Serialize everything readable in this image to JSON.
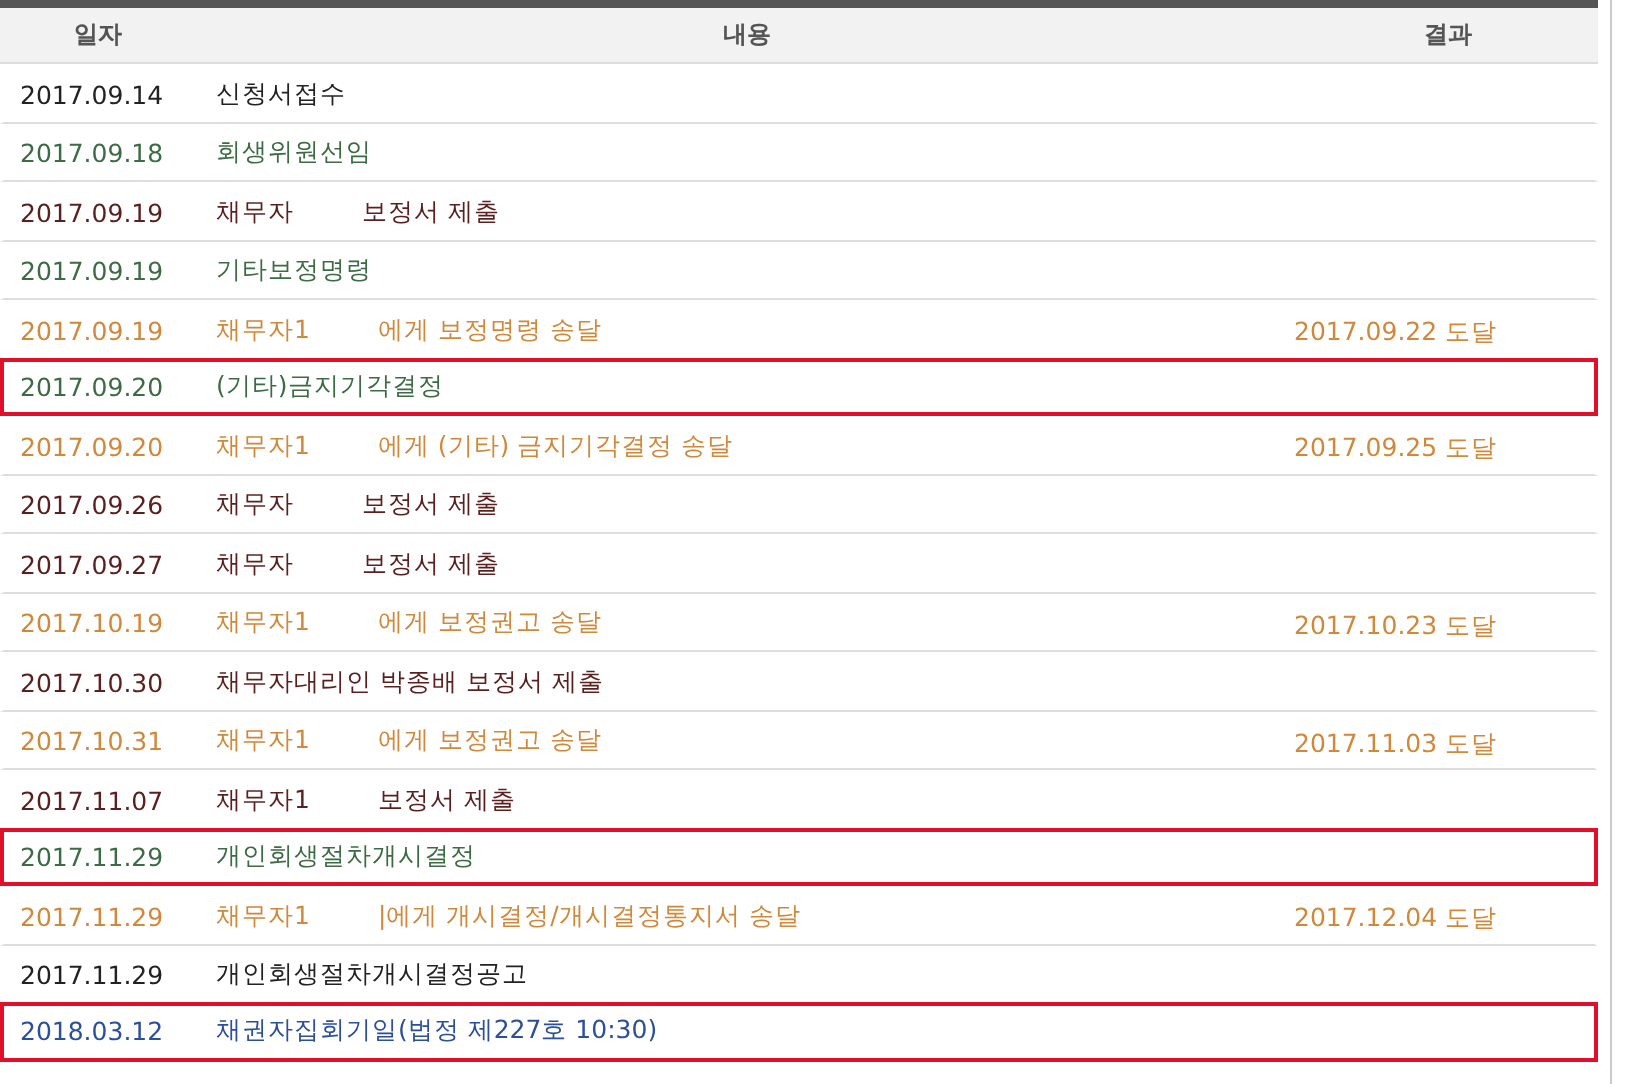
{
  "table": {
    "columns": [
      "일자",
      "내용",
      "결과"
    ],
    "rows": [
      {
        "date": "2017.09.14",
        "content": [
          "신청서접수"
        ],
        "kind": "receipt",
        "highlighted": false
      },
      {
        "date": "2017.09.18",
        "content": [
          "회생위원선임"
        ],
        "kind": "decision",
        "highlighted": false
      },
      {
        "date": "2017.09.19",
        "content": [
          "채무자",
          "보정서 제출"
        ],
        "kind": "submission",
        "highlighted": false
      },
      {
        "date": "2017.09.19",
        "content": [
          "기타보정명령"
        ],
        "kind": "decision",
        "highlighted": false
      },
      {
        "date": "2017.09.19",
        "content": [
          "채무자1",
          "에게 보정명령 송달"
        ],
        "kind": "delivery",
        "result": "2017.09.22 도달",
        "highlighted": false
      },
      {
        "date": "2017.09.20",
        "content": [
          "(기타)금지기각결정"
        ],
        "kind": "decision",
        "highlighted": true
      },
      {
        "date": "2017.09.20",
        "content": [
          "채무자1",
          "에게 (기타) 금지기각결정 송달"
        ],
        "kind": "delivery",
        "result": "2017.09.25 도달",
        "highlighted": false
      },
      {
        "date": "2017.09.26",
        "content": [
          "채무자",
          "보정서 제출"
        ],
        "kind": "submission",
        "highlighted": false
      },
      {
        "date": "2017.09.27",
        "content": [
          "채무자",
          "보정서 제출"
        ],
        "kind": "submission",
        "highlighted": false
      },
      {
        "date": "2017.10.19",
        "content": [
          "채무자1",
          "에게 보정권고 송달"
        ],
        "kind": "delivery",
        "result": "2017.10.23 도달",
        "highlighted": false
      },
      {
        "date": "2017.10.30",
        "content": [
          "채무자대리인 박종배 보정서 제출"
        ],
        "kind": "submission",
        "highlighted": false
      },
      {
        "date": "2017.10.31",
        "content": [
          "채무자1",
          "에게 보정권고 송달"
        ],
        "kind": "delivery",
        "result": "2017.11.03 도달",
        "highlighted": false
      },
      {
        "date": "2017.11.07",
        "content": [
          "채무자1",
          "보정서 제출"
        ],
        "kind": "submission",
        "highlighted": false
      },
      {
        "date": "2017.11.29",
        "content": [
          "개인회생절차개시결정"
        ],
        "kind": "decision",
        "highlighted": true
      },
      {
        "date": "2017.11.29",
        "content": [
          "채무자1",
          "|에게 개시결정/개시결정통지서 송달"
        ],
        "kind": "delivery",
        "result": "2017.12.04 도달",
        "highlighted": false
      },
      {
        "date": "2017.11.29",
        "content": [
          "개인회생절차개시결정공고"
        ],
        "kind": "receipt",
        "highlighted": false
      },
      {
        "date": "2018.03.12",
        "content": [
          "채권자집회기일(법정 제227호 10:30)"
        ],
        "kind": "schedule",
        "highlighted": true
      }
    ]
  }
}
